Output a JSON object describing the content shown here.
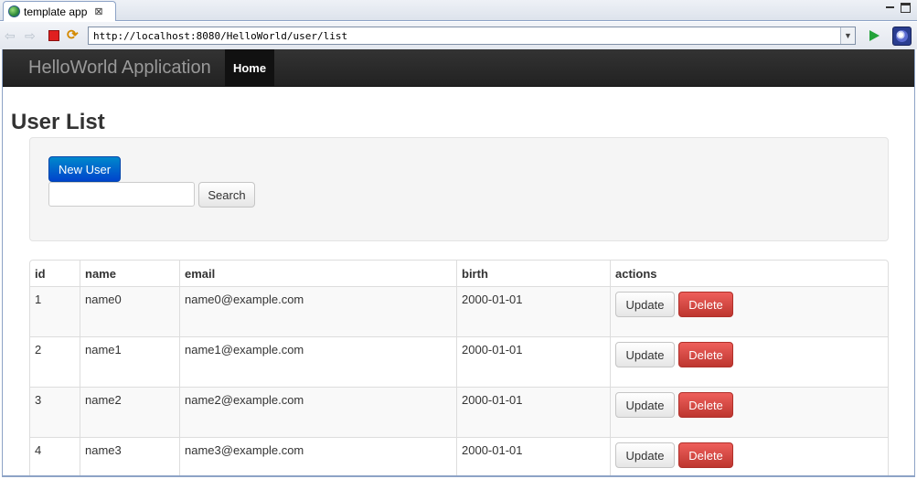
{
  "editor_tab": {
    "title": "template app",
    "close": "⊠"
  },
  "browser": {
    "url": "http://localhost:8080/HelloWorld/user/list",
    "back": "⇦",
    "forward": "⇨",
    "refresh": "⟳",
    "dropdown": "▼"
  },
  "navbar": {
    "brand": "HelloWorld Application",
    "home_label": "Home"
  },
  "page": {
    "heading": "User List"
  },
  "controls": {
    "new_user_label": "New User",
    "search_placeholder": "",
    "search_label": "Search"
  },
  "table": {
    "headers": {
      "id": "id",
      "name": "name",
      "email": "email",
      "birth": "birth",
      "actions": "actions"
    },
    "rows": [
      {
        "id": "1",
        "name": "name0",
        "email": "name0@example.com",
        "birth": "2000-01-01",
        "update": "Update",
        "delete": "Delete"
      },
      {
        "id": "2",
        "name": "name1",
        "email": "name1@example.com",
        "birth": "2000-01-01",
        "update": "Update",
        "delete": "Delete"
      },
      {
        "id": "3",
        "name": "name2",
        "email": "name2@example.com",
        "birth": "2000-01-01",
        "update": "Update",
        "delete": "Delete"
      },
      {
        "id": "4",
        "name": "name3",
        "email": "name3@example.com",
        "birth": "2000-01-01",
        "update": "Update",
        "delete": "Delete"
      }
    ]
  },
  "colors": {
    "navbar": "#222222",
    "primary": "#0044cc",
    "danger": "#da4f49",
    "go": "#23a33a"
  },
  "icons": [
    "globe-icon",
    "close-icon",
    "back-icon",
    "forward-icon",
    "stop-icon",
    "refresh-icon",
    "dropdown-icon",
    "go-icon",
    "eclipse-icon"
  ]
}
